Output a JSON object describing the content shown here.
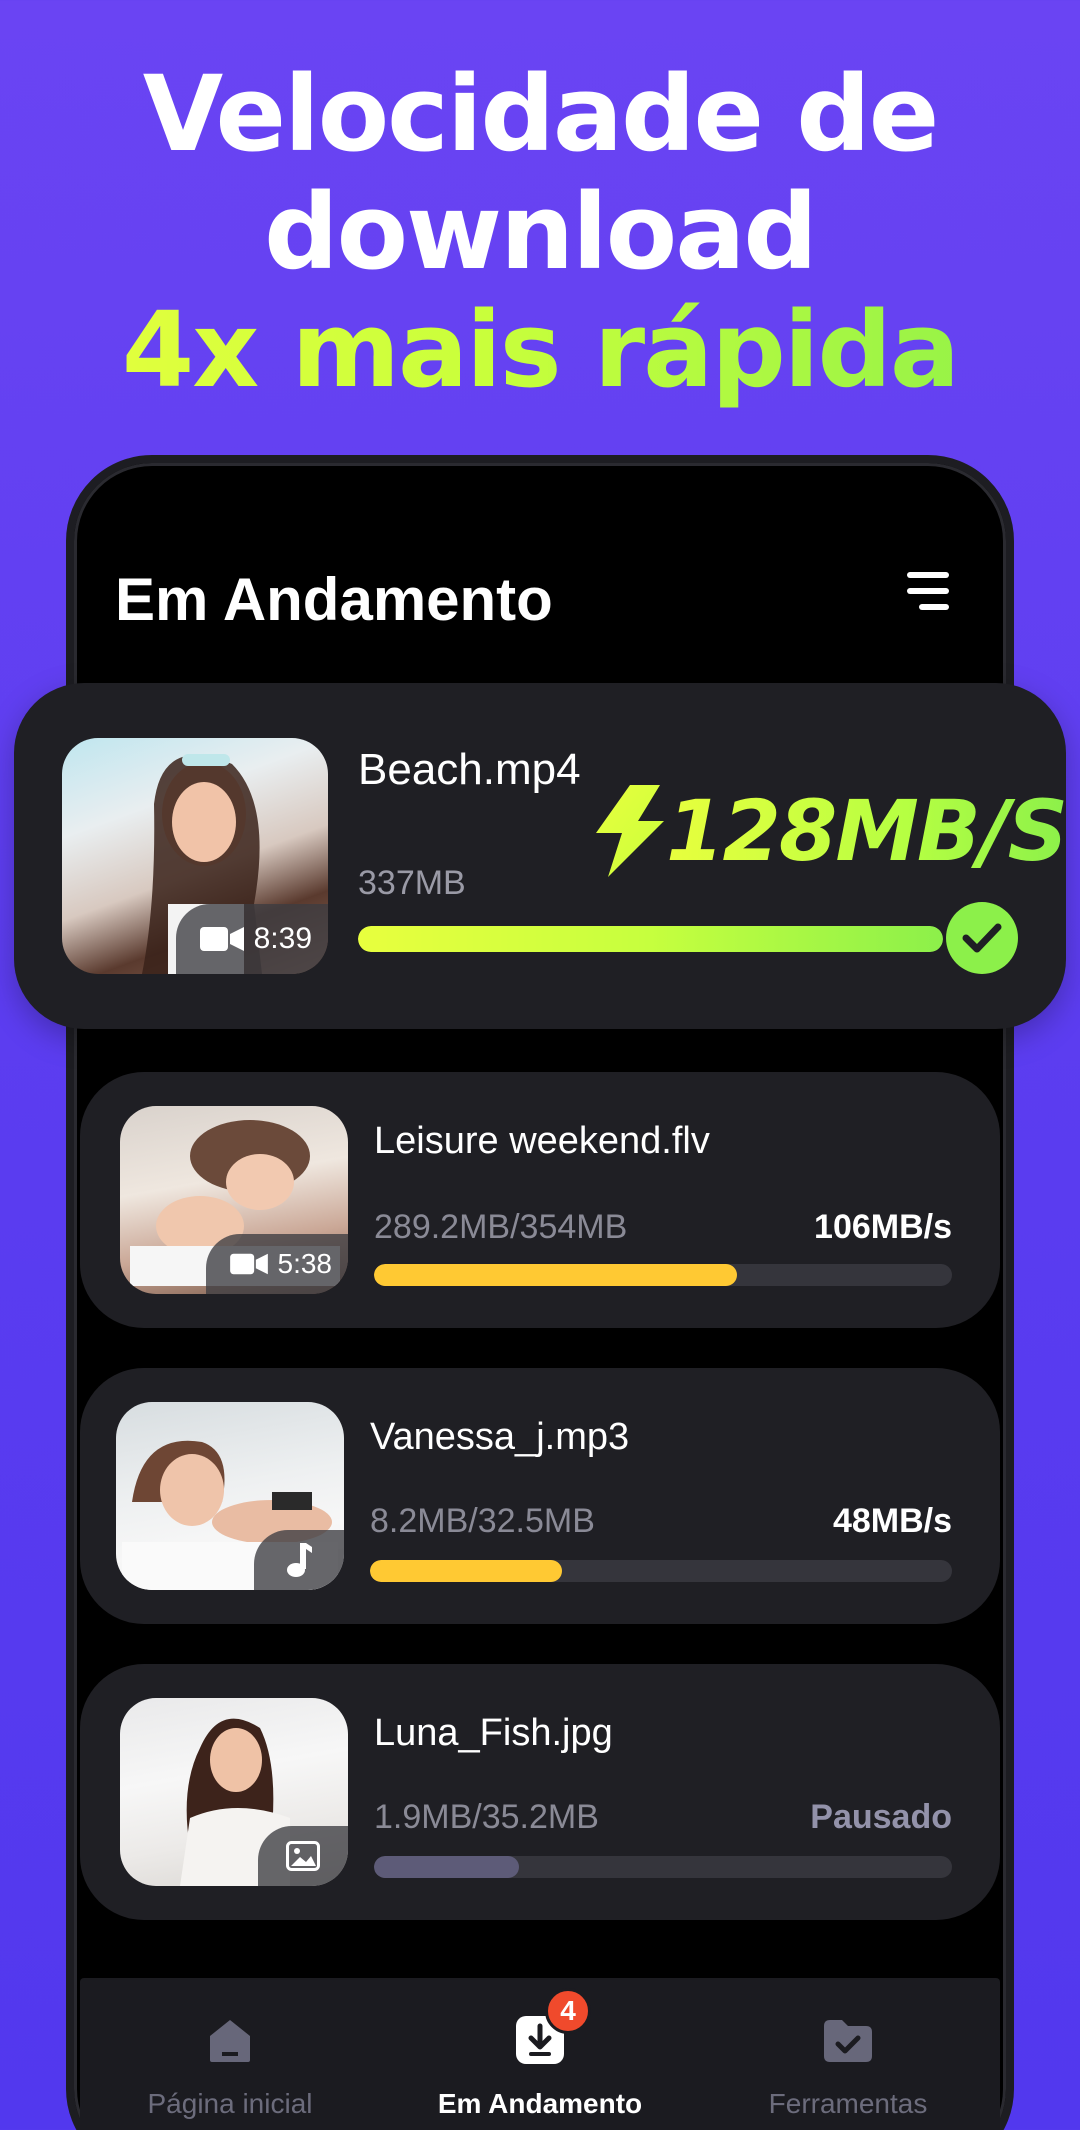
{
  "headline": {
    "line1": "Velocidade de",
    "line2": "download",
    "line3": "4x mais rápida"
  },
  "screen": {
    "title": "Em Andamento",
    "menu_icon": "menu-icon"
  },
  "featured": {
    "name": "Beach.mp4",
    "size": "337MB",
    "speed": "128MB/S",
    "duration": "8:39",
    "type_icon": "video-camera-icon",
    "progress": 1.0,
    "status_icon": "check-icon"
  },
  "downloads": [
    {
      "name": "Leisure weekend.flv",
      "progress_text": "289.2MB/354MB",
      "status": "106MB/s",
      "duration": "5:38",
      "type_icon": "video-camera-icon",
      "progress": 0.628,
      "bar_color": "#ffc933"
    },
    {
      "name": "Vanessa_j.mp3",
      "progress_text": "8.2MB/32.5MB",
      "status": "48MB/s",
      "type_icon": "music-note-icon",
      "progress": 0.33,
      "bar_color": "#ffc933"
    },
    {
      "name": "Luna_Fish.jpg",
      "progress_text": "1.9MB/35.2MB",
      "status": "Pausado",
      "type_icon": "image-icon",
      "progress": 0.25,
      "bar_color": "#5d5b78"
    }
  ],
  "nav": {
    "items": [
      {
        "label": "Página inicial",
        "icon": "home-icon",
        "active": false
      },
      {
        "label": "Em Andamento",
        "icon": "download-icon",
        "active": true
      },
      {
        "label": "Ferramentas",
        "icon": "folder-check-icon",
        "active": false
      }
    ],
    "badge": "4"
  },
  "colors": {
    "background": "#5a3cf0",
    "accent_green": "#8cf04a",
    "accent_yellow": "#e8ff3e",
    "progress_yellow": "#ffc933",
    "paused_gray": "#5d5b78",
    "card": "#1f1f24",
    "badge_red": "#f04a2c"
  }
}
